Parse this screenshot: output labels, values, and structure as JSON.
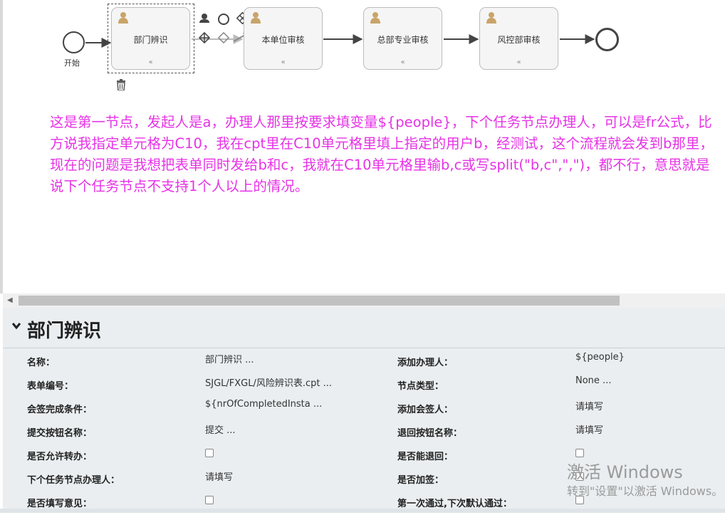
{
  "diagram": {
    "start_label": "开始",
    "tasks": [
      "部门辨识",
      "本单位审核",
      "总部专业审核",
      "风控部审核"
    ]
  },
  "note": "这是第一节点，发起人是a，办理人那里按要求填变量${people}，下个任务节点办理人，可以是fr公式，比方说我指定单元格为C10，我在cpt里在C10单元格里填上指定的用户b，经测试，这个流程就会发到b那里，现在的问题是我想把表单同时发给b和c，我就在C10单元格里输b,c或写split(\"b,c\",\",\")，都不行，意思就是说下个任务节点不支持1个人以上的情况。",
  "properties": {
    "title": "部门辨识",
    "left": [
      {
        "label": "名称：",
        "value": "部门辨识 ..."
      },
      {
        "label": "表单编号：",
        "value": "SJGL/FXGL/风险辨识表.cpt ..."
      },
      {
        "label": "会签完成条件：",
        "value": "${nrOfCompletedInsta ..."
      },
      {
        "label": "提交按钮名称：",
        "value": "提交 ..."
      },
      {
        "label": "是否允许转办：",
        "value": ""
      },
      {
        "label": "下个任务节点办理人：",
        "value": "请填写"
      },
      {
        "label": "是否填写意见：",
        "value": ""
      }
    ],
    "right": [
      {
        "label": "添加办理人：",
        "value": "${people}"
      },
      {
        "label": "节点类型：",
        "value": "None ..."
      },
      {
        "label": "添加会签人：",
        "value": "请填写"
      },
      {
        "label": "退回按钮名称：",
        "value": "请填写"
      },
      {
        "label": "是否能退回：",
        "value": ""
      },
      {
        "label": "是否加签：",
        "value": ""
      },
      {
        "label": "第一次通过,下次默认通过：",
        "value": ""
      }
    ]
  },
  "watermark": {
    "line1": "激活 Windows",
    "line2": "转到\"设置\"以激活 Windows。"
  }
}
